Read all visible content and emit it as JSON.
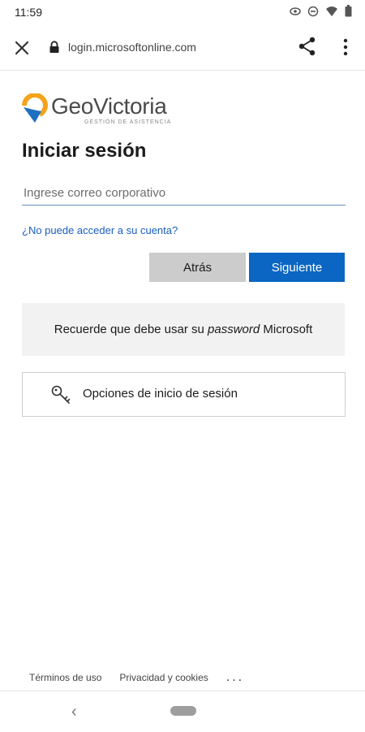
{
  "status_bar": {
    "time": "11:59",
    "icons": [
      "eye-icon",
      "do-not-disturb-icon",
      "wifi-icon",
      "battery-icon"
    ]
  },
  "browser": {
    "url": "login.microsoftonline.com",
    "icons": [
      "close-icon",
      "lock-icon",
      "share-icon",
      "more-vertical-icon"
    ]
  },
  "logo": {
    "brand": "GeoVictoria",
    "tagline": "GESTIÓN DE ASISTENCIA",
    "colors": {
      "orange": "#f4a31b",
      "blue": "#1c6fc1"
    }
  },
  "form": {
    "title": "Iniciar sesión",
    "email_placeholder": "Ingrese correo corporativo",
    "email_value": "",
    "cant_access_link": "¿No puede acceder a su cuenta?",
    "back_button": "Atrás",
    "next_button": "Siguiente"
  },
  "notice": {
    "text_before": "Recuerde que debe usar su ",
    "text_italic": "password",
    "text_after": " Microsoft"
  },
  "signin_options": {
    "label": "Opciones de inicio de sesión",
    "icon": "key-icon"
  },
  "footer": {
    "terms": "Términos de uso",
    "privacy": "Privacidad y cookies",
    "more": "..."
  },
  "nav": {
    "back": "‹",
    "icons": [
      "back-icon",
      "home-pill"
    ]
  },
  "colors": {
    "accent": "#0a66c2",
    "link": "#1a5ec0",
    "secondary_button": "#cccccc",
    "notice_bg": "#f2f2f2"
  }
}
